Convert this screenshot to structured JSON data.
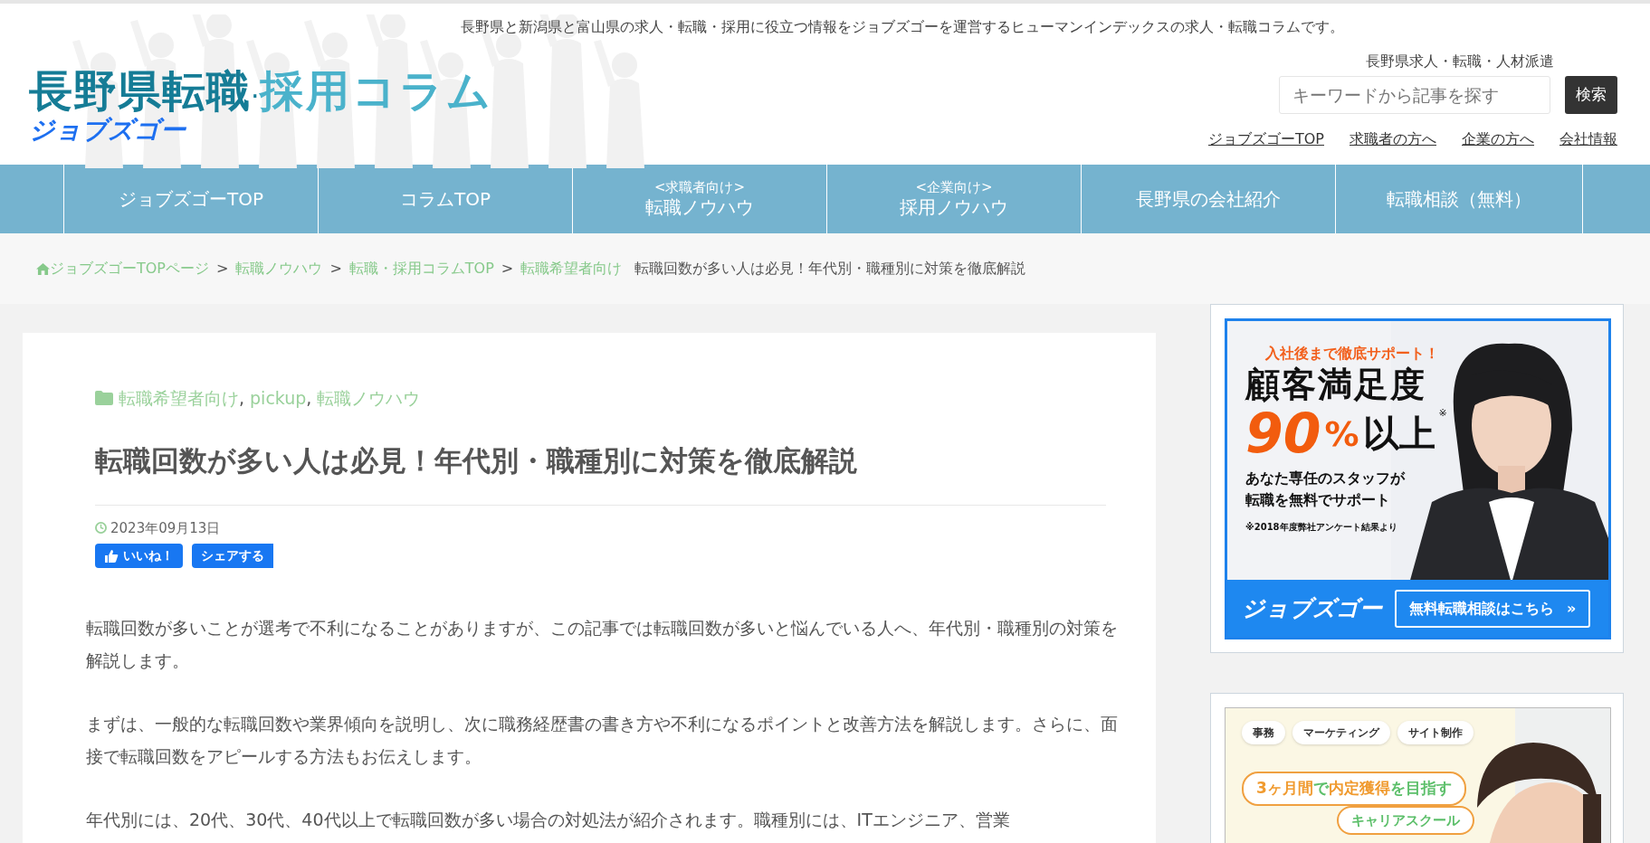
{
  "header": {
    "tagline": "長野県と新潟県と富山県の求人・転職・採用に役立つ情報をジョブズゴーを運営するヒューマンインデックスの求人・転職コラムです。",
    "logo": {
      "title_main": "長野県転職",
      "separator": "·",
      "title_accent": "採用コラム",
      "brand": "ジョブズゴー"
    },
    "region_label": "長野県求人・転職・人材派遣",
    "search": {
      "placeholder": "キーワードから記事を探す",
      "button": "検索"
    },
    "links": [
      "ジョブズゴーTOP",
      "求職者の方へ",
      "企業の方へ",
      "会社情報"
    ]
  },
  "nav": [
    {
      "label": "ジョブズゴーTOP"
    },
    {
      "label": "コラムTOP"
    },
    {
      "sub": "<求職者向け>",
      "label": "転職ノウハウ"
    },
    {
      "sub": "<企業向け>",
      "label": "採用ノウハウ"
    },
    {
      "label": "長野県の会社紹介"
    },
    {
      "label": "転職相談（無料）"
    }
  ],
  "breadcrumb": [
    {
      "kind": "home",
      "label": "ジョブズゴーTOPページ",
      "separator": ">"
    },
    {
      "kind": "link",
      "label": "転職ノウハウ",
      "separator": ">"
    },
    {
      "kind": "link",
      "label": "転職・採用コラムTOP",
      "separator": ">"
    },
    {
      "kind": "link",
      "label": "転職希望者向け"
    },
    {
      "kind": "current",
      "label": "転職回数が多い人は必見！年代別・職種別に対策を徹底解説"
    }
  ],
  "article": {
    "categories": [
      "転職希望者向け",
      "pickup",
      "転職ノウハウ"
    ],
    "category_separator": ",",
    "title": "転職回数が多い人は必見！年代別・職種別に対策を徹底解説",
    "date": "2023年09月13日",
    "social_buttons": [
      {
        "kind": "like",
        "label": "いいね！"
      },
      {
        "kind": "share",
        "label": "シェアする"
      }
    ],
    "paragraphs": [
      "転職回数が多いことが選考で不利になることがありますが、この記事では転職回数が多いと悩んでいる人へ、年代別・職種別の対策を解説します。",
      "まずは、一般的な転職回数や業界傾向を説明し、次に職務経歴書の書き方や不利になるポイントと改善方法を解説します。さらに、面接で転職回数をアピールする方法もお伝えします。",
      "年代別には、20代、30代、40代以上で転職回数が多い場合の対処法が紹介されます。職種別には、ITエンジニア、営業"
    ]
  },
  "sidebar": {
    "banners": [
      {
        "kind": "consulting",
        "kicker": "入社後まで徹底サポート！",
        "headline": "顧客満足度",
        "figure": "90",
        "unit": "%",
        "suffix": "以上",
        "note_mark": "※",
        "lines": [
          "あなた専任のスタッフが",
          "転職を無料でサポート"
        ],
        "footnote": "※2018年度弊社アンケート結果より",
        "brand": "ジョブズゴー",
        "cta": "無料転職相談はこちら",
        "cta_arrow": "»"
      },
      {
        "kind": "school",
        "tags": [
          "事務",
          "マーケティング",
          "サイト制作"
        ],
        "headline_parts": [
          {
            "text": "3ヶ月間",
            "color": "#f09a2e"
          },
          {
            "text": "で",
            "color": "#5cbf6a"
          },
          {
            "text": "内定獲得",
            "color": "#f09a2e"
          },
          {
            "text": "を目指す",
            "color": "#5cbf6a"
          }
        ],
        "subline": "キャリアスクール"
      }
    ]
  }
}
